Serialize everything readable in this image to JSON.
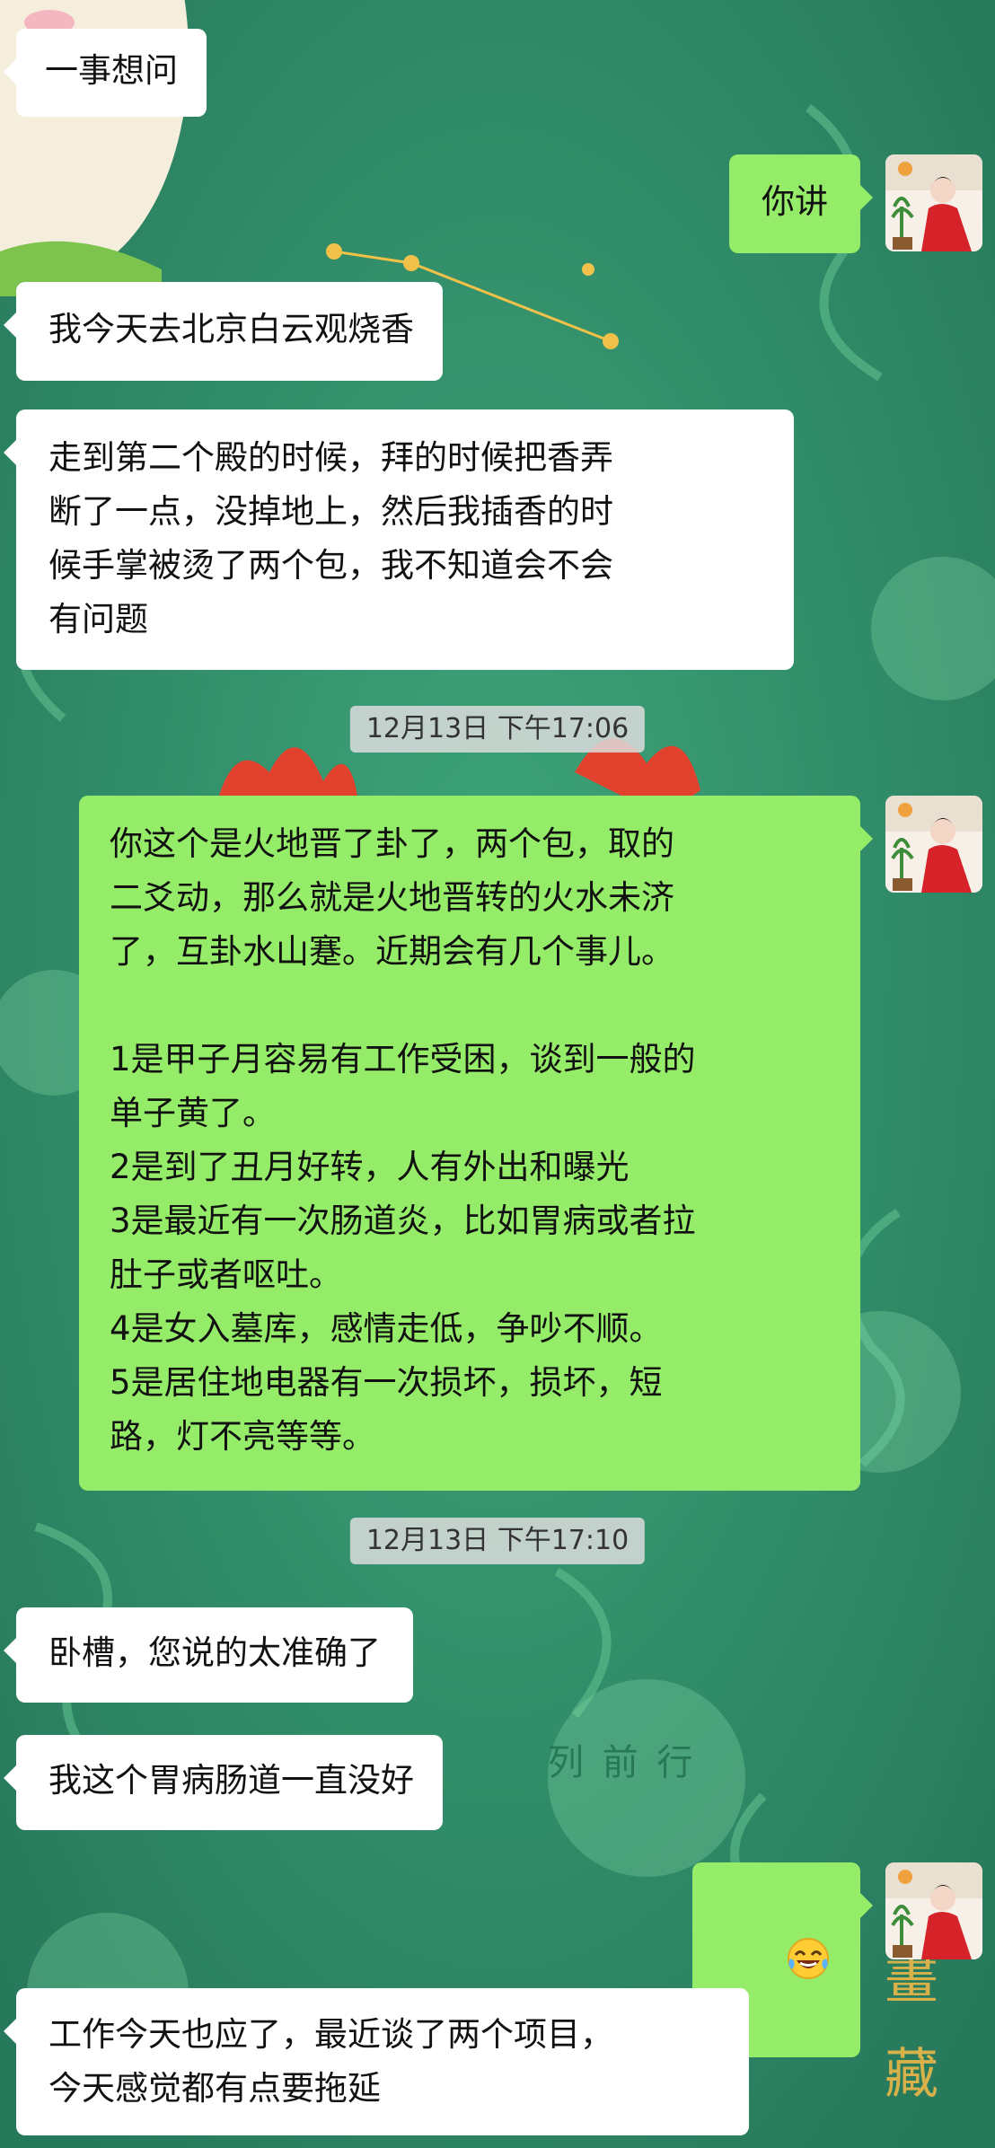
{
  "messages": [
    {
      "side": "in",
      "text": "一事想问"
    },
    {
      "side": "out",
      "text": "你讲"
    },
    {
      "side": "in",
      "text": "我今天去北京白云观烧香"
    },
    {
      "side": "in",
      "text": "走到第二个殿的时候，拜的时候把香弄\n断了一点，没掉地上，然后我插香的时\n候手掌被烫了两个包，我不知道会不会\n有问题"
    },
    {
      "side": "out",
      "text": "你这个是火地晋了卦了，两个包，取的\n二爻动，那么就是火地晋转的火水未济\n了，互卦水山蹇。近期会有几个事儿。\n\n1是甲子月容易有工作受困，谈到一般的\n单子黄了。\n2是到了丑月好转，人有外出和曝光\n3是最近有一次肠道炎，比如胃病或者拉\n肚子或者呕吐。\n4是女入墓库，感情走低，争吵不顺。\n5是居住地电器有一次损坏，损坏，短\n路，灯不亮等等。"
    },
    {
      "side": "in",
      "text": "卧槽，您说的太准确了"
    },
    {
      "side": "in",
      "text": "我这个胃病肠道一直没好"
    },
    {
      "side": "out",
      "emoji": "tears-of-joy-emoji"
    },
    {
      "side": "in",
      "text": "工作今天也应了，最近谈了两个项目，\n今天感觉都有点要拖延"
    }
  ],
  "timestamps": [
    "12月13日 下午17:06",
    "12月13日 下午17:10"
  ],
  "background_text": "列 前 行",
  "colors": {
    "incoming": "#ffffff",
    "outgoing": "#95ec69",
    "background": "#2f8f67"
  }
}
